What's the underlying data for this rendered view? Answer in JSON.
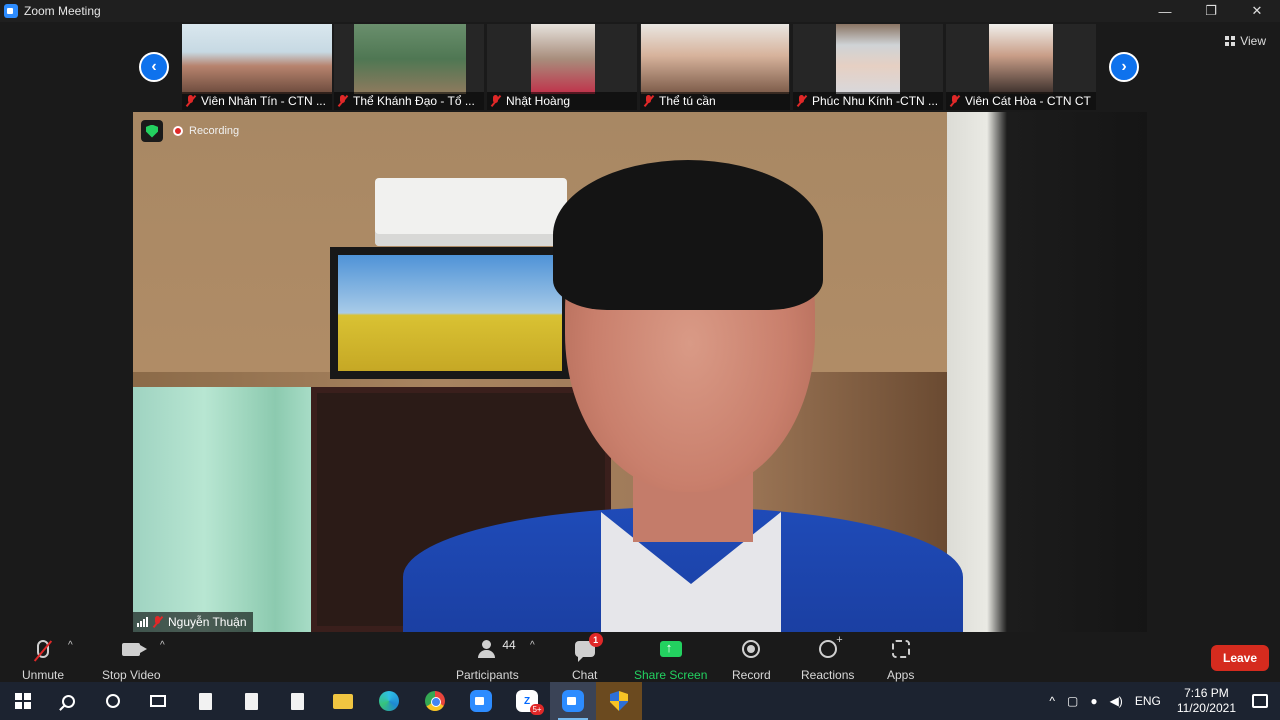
{
  "window": {
    "title": "Zoom Meeting",
    "controls": [
      "—",
      "❐",
      "✕"
    ]
  },
  "gallery": {
    "view_label": "View",
    "participants": [
      {
        "name": "Viên Nhân Tín - CTN ...",
        "muted": true
      },
      {
        "name": "Thể Khánh Đạo - Tổ ...",
        "muted": true
      },
      {
        "name": "Nhật Hoàng",
        "muted": true
      },
      {
        "name": "Thể tú cần",
        "muted": true
      },
      {
        "name": "Phúc Nhu Kính -CTN ...",
        "muted": true
      },
      {
        "name": "Viên Cát Hòa - CTN CT",
        "muted": true
      }
    ]
  },
  "main_video": {
    "recording_label": "Recording",
    "speaker_name": "Nguyễn Thuận",
    "speaker_muted": true
  },
  "toolbar": {
    "unmute_label": "Unmute",
    "stop_video_label": "Stop Video",
    "participants_label": "Participants",
    "participants_count": "44",
    "chat_label": "Chat",
    "chat_unread": "1",
    "share_screen_label": "Share Screen",
    "record_label": "Record",
    "reactions_label": "Reactions",
    "apps_label": "Apps",
    "leave_label": "Leave",
    "share_color": "#23d160",
    "leave_color": "#d52b1e"
  },
  "taskbar": {
    "zalo_badge": "5+",
    "language": "ENG",
    "time": "7:16 PM",
    "date": "11/20/2021"
  }
}
